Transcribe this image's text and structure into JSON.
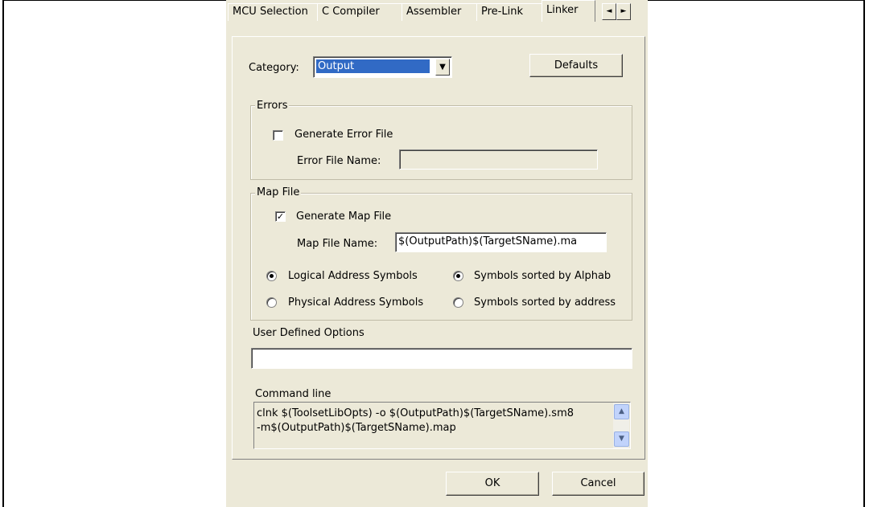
{
  "tabs": [
    {
      "label": "MCU Selection"
    },
    {
      "label": "C Compiler"
    },
    {
      "label": "Assembler"
    },
    {
      "label": "Pre-Link"
    },
    {
      "label": "Linker"
    }
  ],
  "tab_scroll": {
    "left_icon": "◄",
    "right_icon": "►"
  },
  "category": {
    "label": "Category:",
    "value": "Output",
    "dropdown_icon": "▼"
  },
  "defaults_button": "Defaults",
  "errors_group": {
    "title": "Errors",
    "generate_label": "Generate Error File",
    "generate_checked": false,
    "file_name_label": "Error File Name:",
    "file_name_value": ""
  },
  "map_group": {
    "title": "Map File",
    "generate_label": "Generate Map File",
    "generate_checked": true,
    "check_glyph": "✓",
    "file_name_label": "Map File Name:",
    "file_name_value": "$(OutputPath)$(TargetSName).ma",
    "radio_logical": {
      "label": "Logical Address Symbols",
      "selected": true
    },
    "radio_physical": {
      "label": "Physical Address Symbols",
      "selected": false
    },
    "radio_alpha": {
      "label": "Symbols sorted by Alphab",
      "selected": true
    },
    "radio_address": {
      "label": "Symbols sorted by address",
      "selected": false
    }
  },
  "user_options": {
    "label": "User Defined Options",
    "value": ""
  },
  "command_line": {
    "label": "Command line",
    "line1": "clnk $(ToolsetLibOpts) -o $(OutputPath)$(TargetSName).sm8",
    "line2": "-m$(OutputPath)$(TargetSName).map",
    "scroll_up_icon": "▲",
    "scroll_down_icon": "▼"
  },
  "ok_button": "OK",
  "cancel_button": "Cancel"
}
